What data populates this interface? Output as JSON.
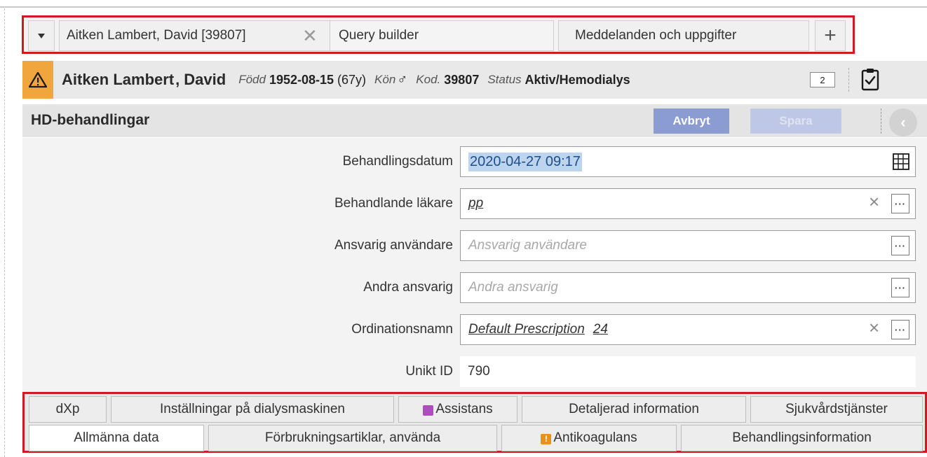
{
  "tabs": [
    {
      "label": "Aitken Lambert, David [39807]"
    },
    {
      "label": "Query builder"
    },
    {
      "label": "Meddelanden och uppgifter"
    }
  ],
  "patient": {
    "name": "Aitken Lambert",
    "sep": ",",
    "first": "David",
    "born_label": "Född",
    "born_date": "1952-08-15",
    "age": "(67y)",
    "sex_label": "Kön",
    "sex_symbol": "♂",
    "code_label": "Kod.",
    "code": "39807",
    "status_label": "Status",
    "status": "Aktiv/Hemodialys",
    "badge": "2"
  },
  "section": {
    "title": "HD-behandlingar",
    "cancel_label": "Avbryt",
    "save_label": "Spara"
  },
  "form": {
    "date_label": "Behandlingsdatum",
    "date_value": "2020-04-27 09:17",
    "doctor_label": "Behandlande läkare",
    "doctor_value": "pp",
    "responsible_label": "Ansvarig användare",
    "responsible_placeholder": "Ansvarig användare",
    "other_label": "Andra ansvarig",
    "other_placeholder": "Andra ansvarig",
    "prescription_label": "Ordinationsnamn",
    "prescription_value": "Default Prescription",
    "prescription_num": "24",
    "uid_label": "Unikt ID",
    "uid_value": "790"
  },
  "bottom_tabs": {
    "row1": [
      "dXp",
      "Inställningar på dialysmaskinen",
      "Assistans",
      "Detaljerad information",
      "Sjukvårdstjänster"
    ],
    "row2": [
      "Allmänna data",
      "Förbrukningsartiklar, använda",
      "Antikoagulans",
      "Behandlingsinformation"
    ]
  },
  "colors": {
    "highlight_border": "#d2191f",
    "warning": "#f0a63c",
    "button_primary": "#8b9cd2",
    "assist_icon": "#b04bc2",
    "anti_icon": "#e8921c"
  }
}
